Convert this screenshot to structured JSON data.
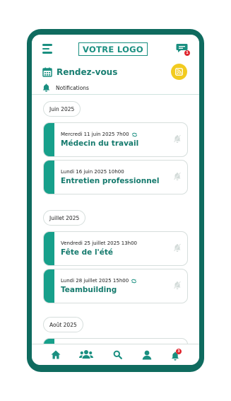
{
  "header": {
    "logo": "VOTRE LOGO",
    "chat_badge": "1",
    "title": "Rendez-vous",
    "notifications_label": "Notifications"
  },
  "sections": [
    {
      "month": "Juin 2025",
      "events": [
        {
          "date": "Mercredi 11 juin 2025 7h00",
          "title": "Médecin du travail",
          "recurring": true
        },
        {
          "date": "Lundi 16 juin 2025 10h00",
          "title": "Entretien professionnel",
          "recurring": false
        }
      ]
    },
    {
      "month": "Juillet 2025",
      "events": [
        {
          "date": "Vendredi 25 juillet 2025 13h00",
          "title": "Fête de l'été",
          "recurring": false
        },
        {
          "date": "Lundi 28 juillet 2025 15h00",
          "title": "Teambuilding",
          "recurring": true
        }
      ]
    },
    {
      "month": "Août 2025",
      "events": []
    }
  ],
  "tabbar": {
    "notifications_badge": "3"
  },
  "colors": {
    "frame": "#0f6b5f",
    "accent": "#17a08b",
    "title": "#157a6d",
    "rss": "#f2cb1f",
    "badge": "#e0262e"
  }
}
